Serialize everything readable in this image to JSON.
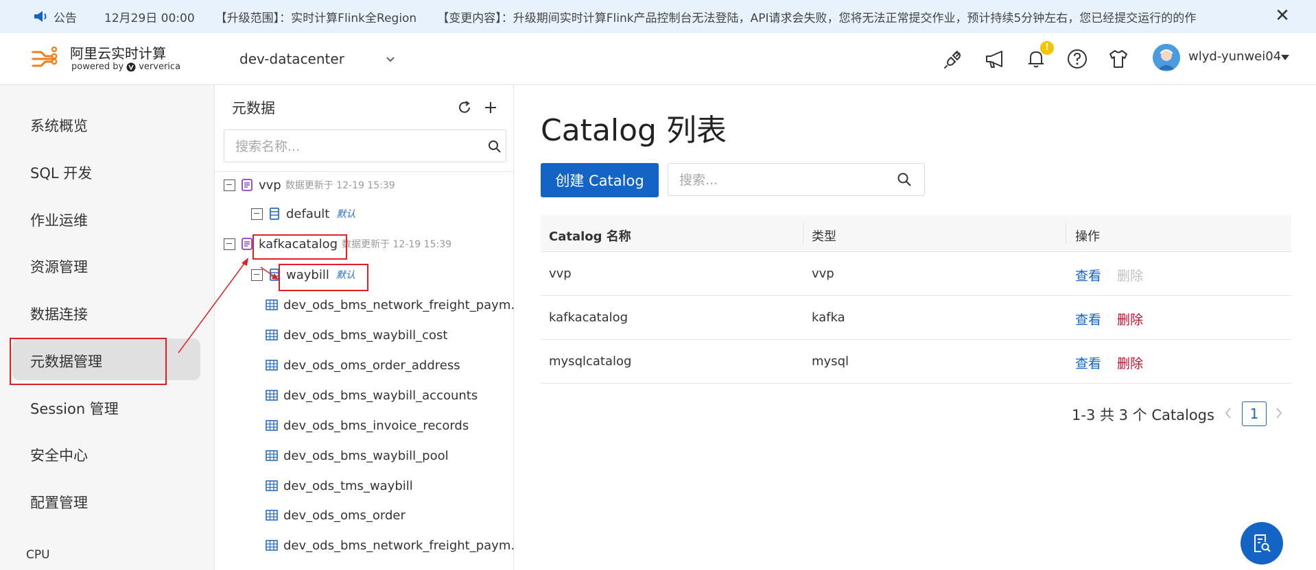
{
  "announcement": {
    "label": "公告",
    "date": "12月29日 00:00",
    "scope": "【升级范围】：实时计算Flink全Region",
    "content": "【变更内容】：升级期间实时计算Flink产品控制台无法登陆，API请求会失败，您将无法正常提交作业，预计持续5分钟左右，您已经提交运行的的作",
    "close_icon": "close-icon"
  },
  "header": {
    "brand": "阿里云实时计算",
    "powered_by": "powered by",
    "vendor": "ververica",
    "workspace": "dev-datacenter",
    "username": "wlyd-yunwei04",
    "notification_badge": "!",
    "icons": [
      "plug-icon",
      "megaphone-icon",
      "bell-icon",
      "help-icon",
      "tshirt-icon"
    ]
  },
  "nav": {
    "items": [
      {
        "label": "系统概览"
      },
      {
        "label": "SQL 开发"
      },
      {
        "label": "作业运维"
      },
      {
        "label": "资源管理"
      },
      {
        "label": "数据连接"
      },
      {
        "label": "元数据管理",
        "active": true
      },
      {
        "label": "Session 管理"
      },
      {
        "label": "安全中心"
      },
      {
        "label": "配置管理"
      }
    ],
    "footer": "CPU"
  },
  "metadata_panel": {
    "title": "元数据",
    "search_placeholder": "搜索名称...",
    "tree": {
      "catalogs": [
        {
          "name": "vvp",
          "meta": "数据更新于 12-19 15:39",
          "databases": [
            {
              "name": "default",
              "tag": "默认"
            }
          ]
        },
        {
          "name": "kafkacatalog",
          "meta": "数据更新于 12-19 15:39",
          "databases": [
            {
              "name": "waybill",
              "tag": "默认"
            }
          ]
        }
      ],
      "tables": [
        "dev_ods_bms_network_freight_paym...",
        "dev_ods_bms_waybill_cost",
        "dev_ods_oms_order_address",
        "dev_ods_bms_waybill_accounts",
        "dev_ods_bms_invoice_records",
        "dev_ods_bms_waybill_pool",
        "dev_ods_tms_waybill",
        "dev_ods_oms_order",
        "dev_ods_bms_network_freight_paym..."
      ]
    }
  },
  "main": {
    "title": "Catalog 列表",
    "create_button": "创建 Catalog",
    "search_placeholder": "搜索...",
    "table": {
      "headers": [
        "Catalog 名称",
        "类型",
        "操作"
      ],
      "rows": [
        {
          "name": "vvp",
          "type": "vvp",
          "view": "查看",
          "delete": "删除",
          "delete_disabled": true
        },
        {
          "name": "kafkacatalog",
          "type": "kafka",
          "view": "查看",
          "delete": "删除",
          "delete_disabled": false
        },
        {
          "name": "mysqlcatalog",
          "type": "mysql",
          "view": "查看",
          "delete": "删除",
          "delete_disabled": false
        }
      ]
    },
    "pagination": {
      "summary": "1-3 共 3 个 Catalogs",
      "current_page": "1"
    }
  },
  "colors": {
    "primary": "#1464c6",
    "danger": "#c8102e",
    "annotation": "#e02020",
    "announce_bg": "#e8f2fd"
  }
}
